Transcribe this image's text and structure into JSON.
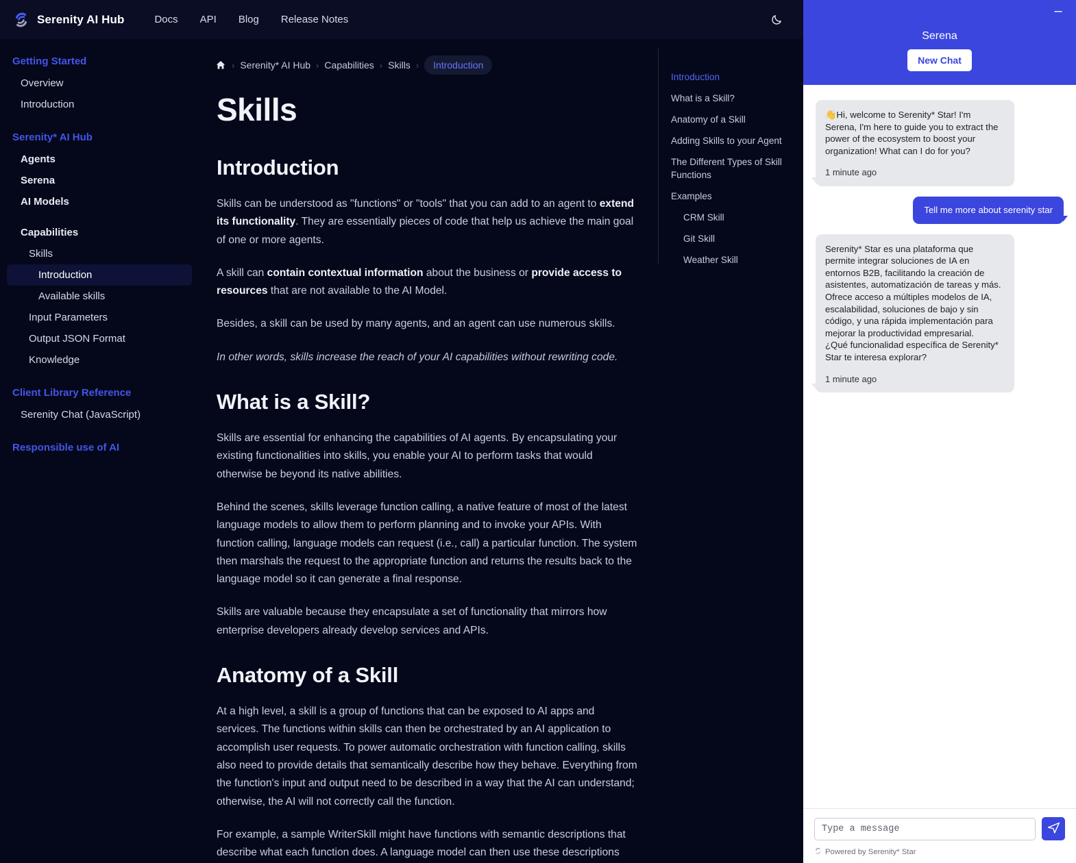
{
  "topnav": {
    "brand": "Serenity AI Hub",
    "logo_icon": "serenity-logo-icon",
    "links": [
      "Docs",
      "API",
      "Blog",
      "Release Notes"
    ],
    "theme_toggle_icon": "moon-icon"
  },
  "sidebar": {
    "groups": [
      {
        "title": "Getting Started",
        "items": [
          {
            "label": "Overview",
            "level": 0,
            "bold": false,
            "active": false
          },
          {
            "label": "Introduction",
            "level": 0,
            "bold": false,
            "active": false
          }
        ]
      },
      {
        "title": "Serenity* AI Hub",
        "items": [
          {
            "label": "Agents",
            "level": 0,
            "bold": true,
            "active": false
          },
          {
            "label": "Serena",
            "level": 0,
            "bold": true,
            "active": false
          },
          {
            "label": "AI Models",
            "level": 0,
            "bold": true,
            "active": false
          },
          {
            "label": "Capabilities",
            "level": 0,
            "bold": true,
            "active": false,
            "spacer_before": true
          },
          {
            "label": "Skills",
            "level": 1,
            "bold": false,
            "active": false
          },
          {
            "label": "Introduction",
            "level": 2,
            "bold": false,
            "active": true
          },
          {
            "label": "Available skills",
            "level": 2,
            "bold": false,
            "active": false
          },
          {
            "label": "Input Parameters",
            "level": 1,
            "bold": false,
            "active": false
          },
          {
            "label": "Output JSON Format",
            "level": 1,
            "bold": false,
            "active": false
          },
          {
            "label": "Knowledge",
            "level": 1,
            "bold": false,
            "active": false
          }
        ]
      },
      {
        "title": "Client Library Reference",
        "items": [
          {
            "label": "Serenity Chat (JavaScript)",
            "level": 0,
            "bold": false,
            "active": false
          }
        ]
      },
      {
        "title": "Responsible use of AI",
        "items": []
      }
    ]
  },
  "breadcrumb": {
    "home_icon": "home-icon",
    "separator": "›",
    "items": [
      "Serenity* AI Hub",
      "Capabilities",
      "Skills"
    ],
    "current": "Introduction"
  },
  "main": {
    "title": "Skills",
    "sections": [
      {
        "heading": "Introduction",
        "paragraphs": [
          {
            "html": "Skills can be understood as \"functions\" or \"tools\" that you can add to an agent to <b>extend its functionality</b>. They are essentially pieces of code that help us achieve the main goal of one or more agents.",
            "italic": false
          },
          {
            "html": "A skill can <b>contain contextual information</b> about the business or <b>provide access to resources</b> that are not available to the AI Model.",
            "italic": false
          },
          {
            "html": "Besides, a skill can be used by many agents, and an agent can use numerous skills.",
            "italic": false
          },
          {
            "html": "In other words, skills increase the reach of your AI capabilities without rewriting code.",
            "italic": true
          }
        ]
      },
      {
        "heading": "What is a Skill?",
        "paragraphs": [
          {
            "html": "Skills are essential for enhancing the capabilities of AI agents. By encapsulating your existing functionalities into skills, you enable your AI to perform tasks that would otherwise be beyond its native abilities.",
            "italic": false
          },
          {
            "html": "Behind the scenes, skills leverage function calling, a native feature of most of the latest language models to allow them to perform planning and to invoke your APIs. With function calling, language models can request (i.e., call) a particular function. The system then marshals the request to the appropriate function and returns the results back to the language model so it can generate a final response.",
            "italic": false
          },
          {
            "html": "Skills are valuable because they encapsulate a set of functionality that mirrors how enterprise developers already develop services and APIs.",
            "italic": false
          }
        ]
      },
      {
        "heading": "Anatomy of a Skill",
        "paragraphs": [
          {
            "html": "At a high level, a skill is a group of functions that can be exposed to AI apps and services. The functions within skills can then be orchestrated by an AI application to accomplish user requests. To power automatic orchestration with function calling, skills also need to provide details that semantically describe how they behave. Everything from the function's input and output need to be described in a way that the AI can understand; otherwise, the AI will not correctly call the function.",
            "italic": false
          },
          {
            "html": "For example, a sample WriterSkill might have functions with semantic descriptions that describe what each function does. A language model can then use these descriptions",
            "italic": false
          }
        ]
      }
    ]
  },
  "toc": {
    "items": [
      {
        "label": "Introduction",
        "active": true,
        "sub": false
      },
      {
        "label": "What is a Skill?",
        "active": false,
        "sub": false
      },
      {
        "label": "Anatomy of a Skill",
        "active": false,
        "sub": false
      },
      {
        "label": "Adding Skills to your Agent",
        "active": false,
        "sub": false
      },
      {
        "label": "The Different Types of Skill Functions",
        "active": false,
        "sub": false
      },
      {
        "label": "Examples",
        "active": false,
        "sub": false
      },
      {
        "label": "CRM Skill",
        "active": false,
        "sub": true
      },
      {
        "label": "Git Skill",
        "active": false,
        "sub": true
      },
      {
        "label": "Weather Skill",
        "active": false,
        "sub": true
      }
    ]
  },
  "chat": {
    "title": "Serena",
    "minimize_icon": "minimize-icon",
    "new_chat_label": "New Chat",
    "messages": [
      {
        "from": "bot",
        "text": "👋Hi, welcome to Serenity* Star! I'm Serena, I'm here to guide you to extract the power of the ecosystem to boost your organization! What can I do for you?",
        "time": "1 minute ago"
      },
      {
        "from": "user",
        "text": "Tell me more about serenity star",
        "time": ""
      },
      {
        "from": "bot",
        "text": "Serenity* Star es una plataforma que permite integrar soluciones de IA en entornos B2B, facilitando la creación de asistentes, automatización de tareas y más. Ofrece acceso a múltiples modelos de IA, escalabilidad, soluciones de bajo y sin código, y una rápida implementación para mejorar la productividad empresarial.\n¿Qué funcionalidad específica de Serenity* Star te interesa explorar?",
        "time": "1 minute ago"
      }
    ],
    "composer": {
      "placeholder": "Type a message",
      "value": "",
      "send_icon": "send-icon"
    },
    "powered_by": "Powered by Serenity* Star",
    "powered_icon": "serenity-logo-icon"
  },
  "colors": {
    "accent_blue": "#3b46de",
    "nav_link_blue": "#4355e8",
    "page_bg": "#05081a",
    "topnav_bg": "#0a0d24",
    "bot_bubble": "#e7e8eb"
  }
}
